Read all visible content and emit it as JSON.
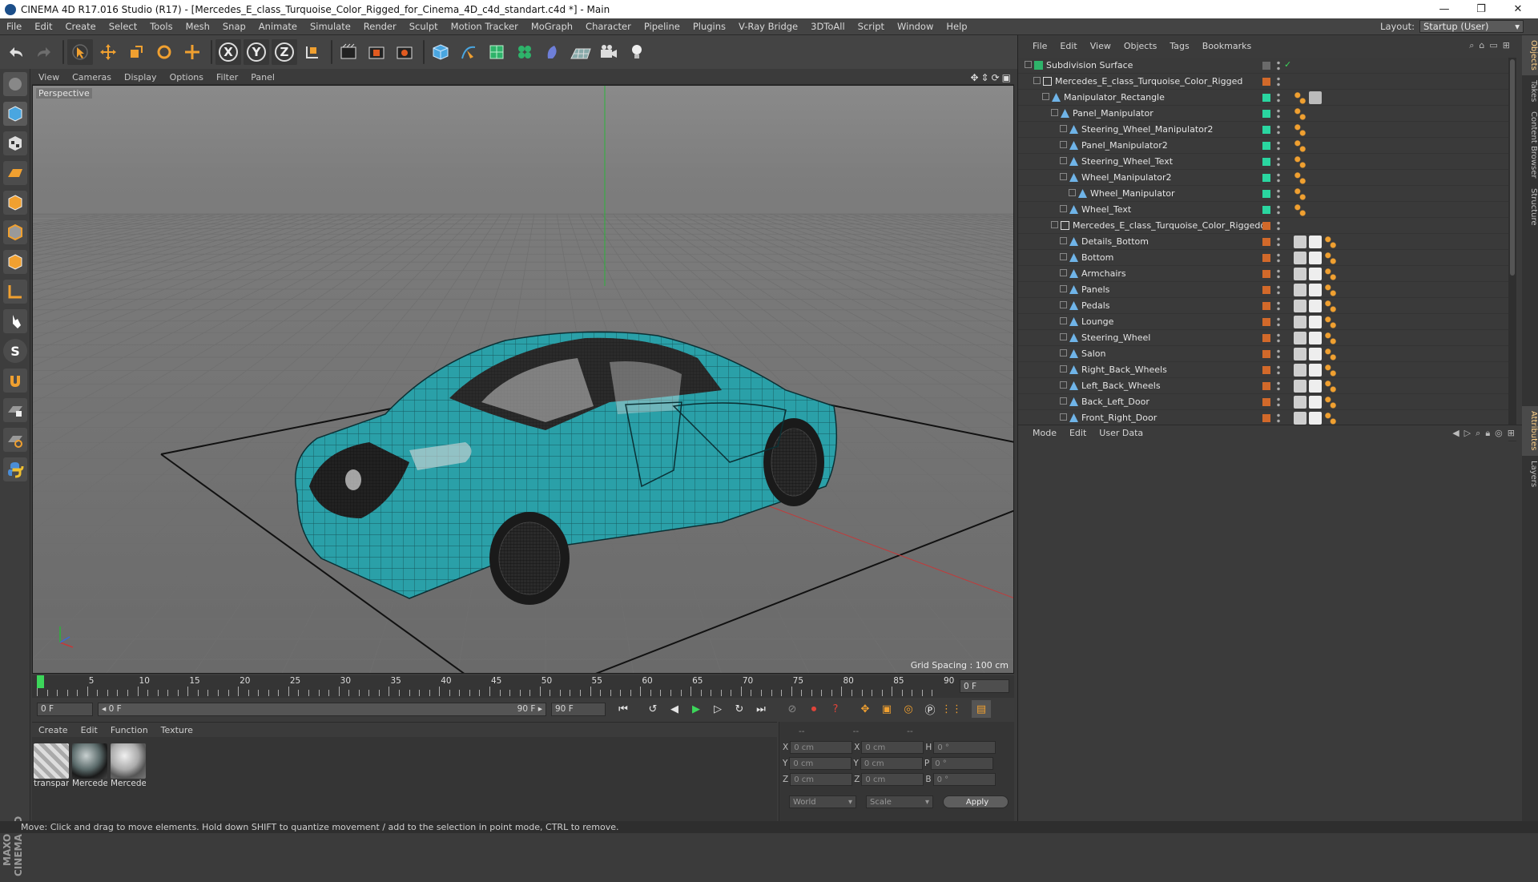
{
  "window": {
    "title": "CINEMA 4D R17.016 Studio (R17) - [Mercedes_E_class_Turquoise_Color_Rigged_for_Cinema_4D_c4d_standart.c4d *] - Main",
    "minimize": "—",
    "restore": "❐",
    "close": "✕"
  },
  "menubar": [
    "File",
    "Edit",
    "Create",
    "Select",
    "Tools",
    "Mesh",
    "Snap",
    "Animate",
    "Simulate",
    "Render",
    "Sculpt",
    "Motion Tracker",
    "MoGraph",
    "Character",
    "Pipeline",
    "Plugins",
    "V-Ray Bridge",
    "3DToAll",
    "Script",
    "Window",
    "Help"
  ],
  "layout": {
    "label": "Layout:",
    "value": "Startup (User)"
  },
  "toolbar_icons": [
    "undo-icon",
    "redo-icon",
    "select-icon",
    "move-icon",
    "scale-icon",
    "rotate-icon",
    "live-icon",
    "x-axis-icon",
    "y-axis-icon",
    "z-axis-icon",
    "coord-system-icon",
    "render-view-icon",
    "render-picture-viewer-icon",
    "render-settings-icon",
    "cube-icon",
    "pen-icon",
    "subdivision-icon",
    "cloner-icon",
    "deformer-icon",
    "floor-icon",
    "camera-icon",
    "light-icon"
  ],
  "toolbar_letters": {
    "x": "X",
    "y": "Y",
    "z": "Z"
  },
  "viewport": {
    "menu": [
      "View",
      "Cameras",
      "Display",
      "Options",
      "Filter",
      "Panel"
    ],
    "label": "Perspective",
    "grid_spacing": "Grid Spacing : 100 cm"
  },
  "timeline": {
    "ticks": [
      "0",
      "5",
      "10",
      "15",
      "20",
      "25",
      "30",
      "35",
      "40",
      "45",
      "50",
      "55",
      "60",
      "65",
      "70",
      "75",
      "80",
      "85",
      "90"
    ],
    "current_frame": "0 F",
    "start": "0 F",
    "range_start": "◂ 0 F",
    "range_end": "90 F ▸",
    "end": "90 F"
  },
  "material_manager": {
    "menu": [
      "Create",
      "Edit",
      "Function",
      "Texture"
    ],
    "materials": [
      "transpar",
      "Mercede",
      "Mercede"
    ]
  },
  "coordinates": {
    "header": [
      "--",
      "--",
      "--"
    ],
    "rows": [
      {
        "a": "X",
        "av": "0 cm",
        "b": "X",
        "bv": "0 cm",
        "c": "H",
        "cv": "0 °"
      },
      {
        "a": "Y",
        "av": "0 cm",
        "b": "Y",
        "bv": "0 cm",
        "c": "P",
        "cv": "0 °"
      },
      {
        "a": "Z",
        "av": "0 cm",
        "b": "Z",
        "bv": "0 cm",
        "c": "B",
        "cv": "0 °"
      }
    ],
    "mode": "World",
    "scale": "Scale",
    "apply": "Apply"
  },
  "object_manager": {
    "menu": [
      "File",
      "Edit",
      "View",
      "Objects",
      "Tags",
      "Bookmarks"
    ],
    "objects": [
      {
        "name": "Subdivision Surface",
        "indent": 0,
        "icon": "subdivision",
        "color": "#6a6a6a",
        "check": "✓"
      },
      {
        "name": "Mercedes_E_class_Turquoise_Color_Rigged",
        "indent": 1,
        "icon": "null",
        "color": "#d2692a"
      },
      {
        "name": "Manipulator_Rectangle",
        "indent": 2,
        "icon": "spline",
        "color": "#2ad6a0"
      },
      {
        "name": "Panel_Manipulator",
        "indent": 3,
        "icon": "spline",
        "color": "#2ad6a0"
      },
      {
        "name": "Steering_Wheel_Manipulator2",
        "indent": 4,
        "icon": "spline",
        "color": "#2ad6a0"
      },
      {
        "name": "Panel_Manipulator2",
        "indent": 4,
        "icon": "spline",
        "color": "#2ad6a0"
      },
      {
        "name": "Steering_Wheel_Text",
        "indent": 4,
        "icon": "spline",
        "color": "#2ad6a0"
      },
      {
        "name": "Wheel_Manipulator2",
        "indent": 4,
        "icon": "spline",
        "color": "#2ad6a0"
      },
      {
        "name": "Wheel_Manipulator",
        "indent": 5,
        "icon": "spline",
        "color": "#2ad6a0"
      },
      {
        "name": "Wheel_Text",
        "indent": 4,
        "icon": "spline",
        "color": "#2ad6a0"
      },
      {
        "name": "Mercedes_E_class_Turquoise_Color_Riggedd",
        "indent": 3,
        "icon": "null",
        "color": "#d2692a"
      },
      {
        "name": "Details_Bottom",
        "indent": 4,
        "icon": "poly",
        "color": "#d2692a"
      },
      {
        "name": "Bottom",
        "indent": 4,
        "icon": "poly",
        "color": "#d2692a"
      },
      {
        "name": "Armchairs",
        "indent": 4,
        "icon": "poly",
        "color": "#d2692a"
      },
      {
        "name": "Panels",
        "indent": 4,
        "icon": "poly",
        "color": "#d2692a"
      },
      {
        "name": "Pedals",
        "indent": 4,
        "icon": "poly",
        "color": "#d2692a"
      },
      {
        "name": "Lounge",
        "indent": 4,
        "icon": "poly",
        "color": "#d2692a"
      },
      {
        "name": "Steering_Wheel",
        "indent": 4,
        "icon": "poly",
        "color": "#d2692a"
      },
      {
        "name": "Salon",
        "indent": 4,
        "icon": "poly",
        "color": "#d2692a"
      },
      {
        "name": "Right_Back_Wheels",
        "indent": 4,
        "icon": "poly",
        "color": "#d2692a"
      },
      {
        "name": "Left_Back_Wheels",
        "indent": 4,
        "icon": "poly",
        "color": "#d2692a"
      },
      {
        "name": "Back_Left_Door",
        "indent": 4,
        "icon": "poly",
        "color": "#d2692a"
      },
      {
        "name": "Front_Right_Door",
        "indent": 4,
        "icon": "poly",
        "color": "#d2692a"
      }
    ]
  },
  "attributes": {
    "menu": [
      "Mode",
      "Edit",
      "User Data"
    ]
  },
  "side_tabs": [
    "Objects",
    "Takes",
    "Content Browser",
    "Structure",
    "Attributes",
    "Layers"
  ],
  "status": "Move: Click and drag to move elements. Hold down SHIFT to quantize movement / add to the selection in point mode, CTRL to remove.",
  "maxon_logo": "MAXON CINEMA 4D",
  "colors": {
    "accent": "#f0a030",
    "turquoise": "#2aa0a8",
    "green_tag": "#2ad6a0",
    "orange_tag": "#d2692a"
  }
}
